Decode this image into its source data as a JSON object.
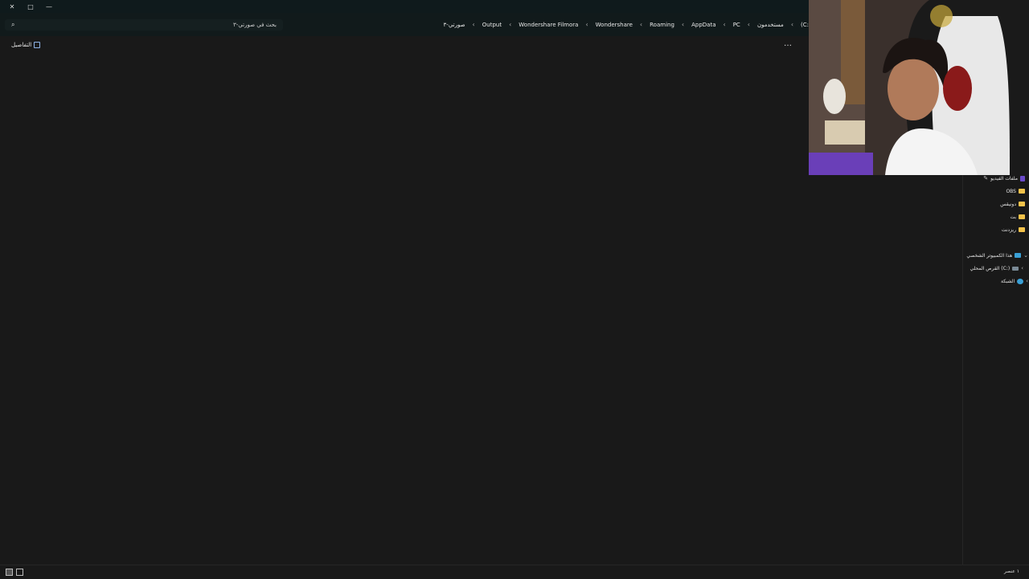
{
  "window": {
    "close_glyph": "✕",
    "maximize_glyph": "□",
    "minimize_glyph": "—"
  },
  "search": {
    "placeholder": "بحث في صورتي-٣"
  },
  "breadcrumb": {
    "items": [
      "(C:",
      "مستخدمون",
      "PC",
      "AppData",
      "Roaming",
      "Wondershare",
      "Wondershare Filmora",
      "Output",
      "صورتي-٣"
    ]
  },
  "toolbar": {
    "details_label": "التفاصيل",
    "more_glyph": "…"
  },
  "nav": {
    "items": [
      {
        "label": "ملفات الفيديو",
        "icon": "video-icon"
      },
      {
        "label": "OBS",
        "icon": "folder-icon"
      },
      {
        "label": "دونيقس",
        "icon": "folder-icon"
      },
      {
        "label": "بت",
        "icon": "folder-icon"
      },
      {
        "label": "ريزدنت",
        "icon": "folder-icon"
      },
      {
        "label": "هذا الكمبيوتر الشخصي",
        "icon": "pc-icon"
      },
      {
        "label": "القرص المحلي (C:)",
        "icon": "drive-icon"
      },
      {
        "label": "الشبكة",
        "icon": "network-icon"
      }
    ]
  },
  "status": {
    "item_count": "١ عنصر"
  },
  "colors": {
    "background": "#191919",
    "titlebar": "#0f1a1c",
    "folder": "#f3c24a",
    "accent": "#3aa0d6"
  }
}
